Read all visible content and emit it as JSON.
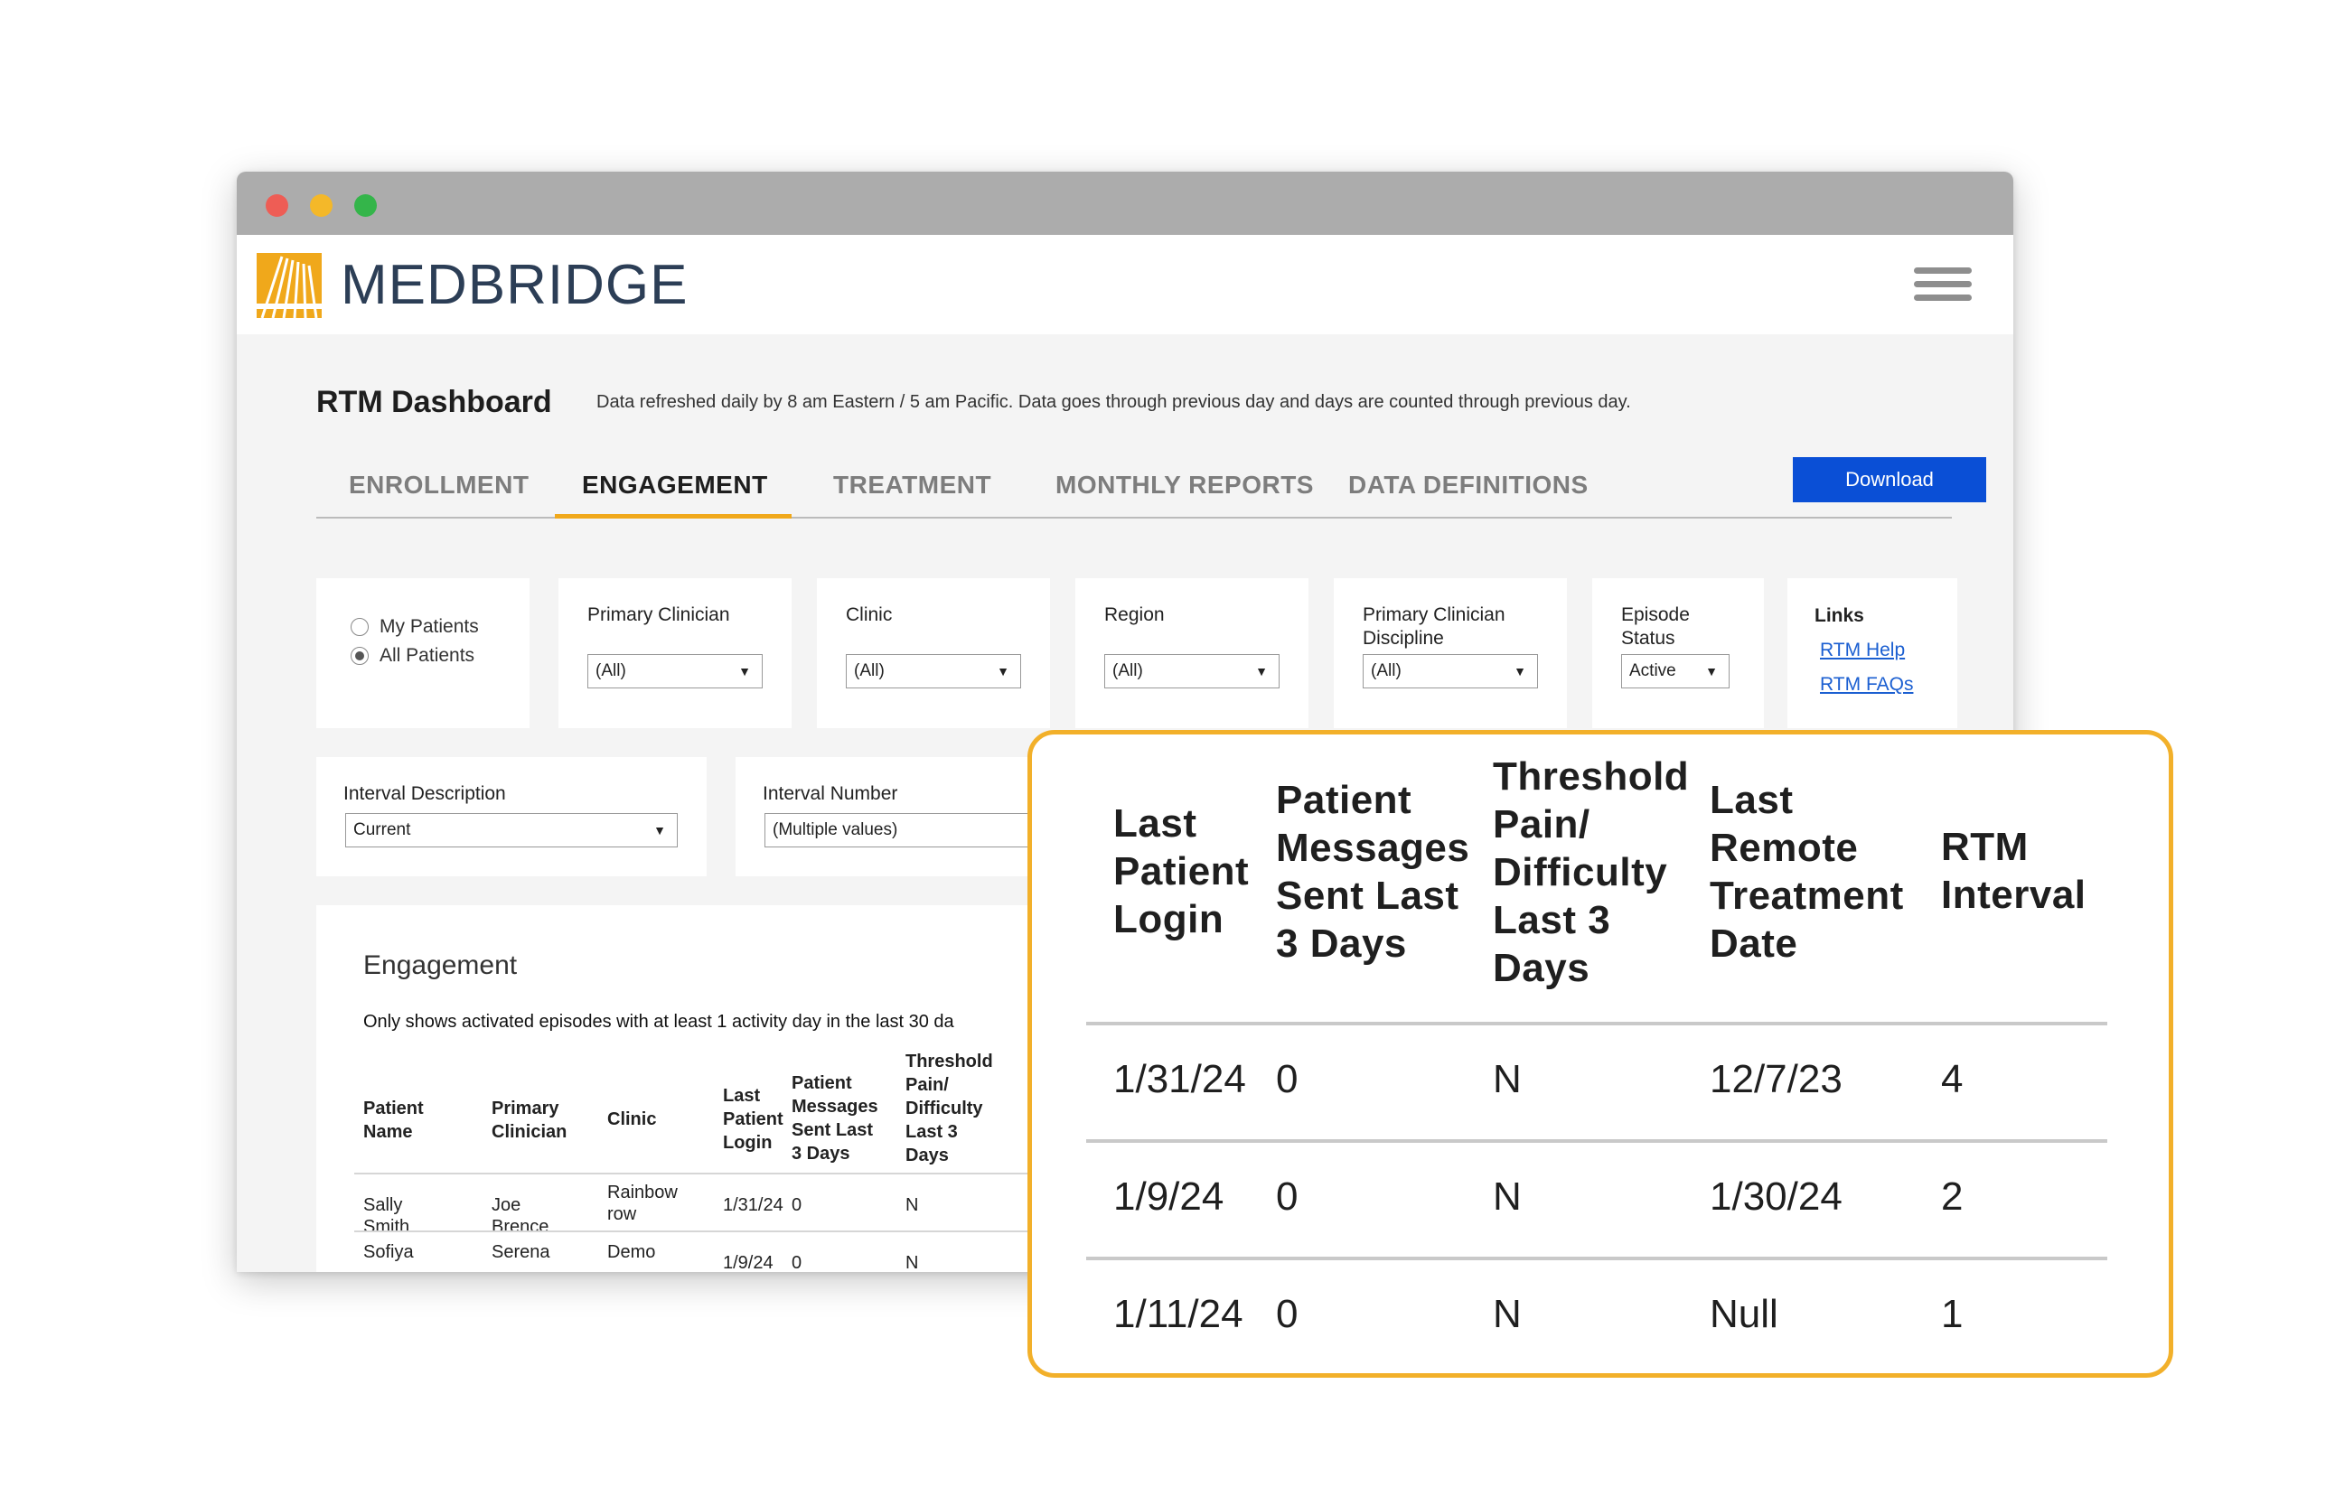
{
  "brand": {
    "name": "MEDBRIDGE",
    "accent": "#f0a81b",
    "text_color": "#2c3e56"
  },
  "dashboard": {
    "title": "RTM Dashboard",
    "refresh_note": "Data refreshed daily by 8 am Eastern / 5 am Pacific. Data goes through previous day and days are counted through previous day."
  },
  "tabs": [
    {
      "label": "ENROLLMENT",
      "active": false
    },
    {
      "label": "ENGAGEMENT",
      "active": true
    },
    {
      "label": "TREATMENT",
      "active": false
    },
    {
      "label": "MONTHLY REPORTS",
      "active": false
    },
    {
      "label": "DATA DEFINITIONS",
      "active": false
    }
  ],
  "download_label": "Download",
  "filters": {
    "patients_scope": {
      "options": [
        "My Patients",
        "All Patients"
      ],
      "selected": "All Patients"
    },
    "primary_clinician": {
      "label": "Primary Clinician",
      "value": "(All)"
    },
    "clinic": {
      "label": "Clinic",
      "value": "(All)"
    },
    "region": {
      "label": "Region",
      "value": "(All)"
    },
    "primary_clinician_discipline": {
      "label_line1": "Primary Clinician",
      "label_line2": "Discipline",
      "value": "(All)"
    },
    "episode_status": {
      "label_line1": "Episode",
      "label_line2": "Status",
      "value": "Active"
    },
    "interval_description": {
      "label": "Interval Description",
      "value": "Current"
    },
    "interval_number": {
      "label": "Interval Number",
      "value": "(Multiple values)"
    }
  },
  "links": {
    "title": "Links",
    "items": [
      "RTM Help",
      "RTM FAQs"
    ]
  },
  "engagement": {
    "title": "Engagement",
    "subtitle": "Only shows activated episodes with at least 1 activity day in the last 30 da",
    "headers": [
      [
        "Patient",
        "Name"
      ],
      [
        "Primary",
        "Clinician"
      ],
      [
        "Clinic"
      ],
      [
        "Last",
        "Patient",
        "Login"
      ],
      [
        "Patient",
        "Messages",
        "Sent Last",
        "3 Days"
      ],
      [
        "Threshold",
        "Pain/",
        "Difficulty",
        "Last 3",
        "Days"
      ]
    ],
    "rows": [
      {
        "patient": "Sally Smith",
        "clinician": "Joe Brence",
        "clinic_line1": "Rainbow",
        "clinic_line2": "row",
        "last_login": "1/31/24",
        "messages": "0",
        "threshold": "N"
      },
      {
        "patient": "Sofiya",
        "clinician": "Serena",
        "clinic_line1": "Demo",
        "clinic_line2": "",
        "last_login": "1/9/24",
        "messages": "0",
        "threshold": "N"
      }
    ]
  },
  "zoom": {
    "headers": [
      [
        "Last",
        "Patient",
        "Login"
      ],
      [
        "Patient",
        "Messages",
        "Sent Last",
        "3 Days"
      ],
      [
        "Threshold",
        "Pain/",
        "Difficulty",
        "Last 3",
        "Days"
      ],
      [
        "Last",
        "Remote",
        "Treatment",
        "Date"
      ],
      [
        "RTM",
        "Interval"
      ]
    ],
    "rows": [
      [
        "1/31/24",
        "0",
        "N",
        "12/7/23",
        "4"
      ],
      [
        "1/9/24",
        "0",
        "N",
        "1/30/24",
        "2"
      ],
      [
        "1/11/24",
        "0",
        "N",
        "Null",
        "1"
      ]
    ]
  }
}
